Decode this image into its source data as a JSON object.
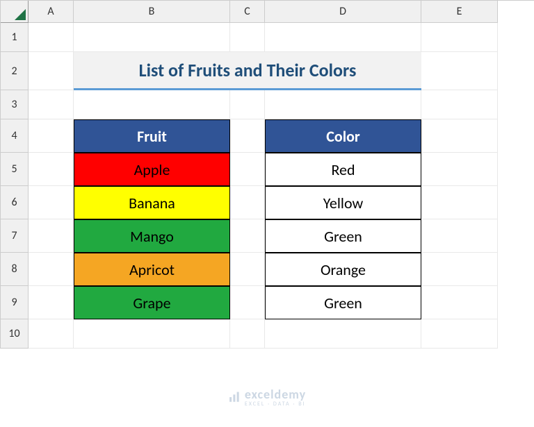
{
  "columns": [
    "A",
    "B",
    "C",
    "D",
    "E"
  ],
  "rows": [
    "1",
    "2",
    "3",
    "4",
    "5",
    "6",
    "7",
    "8",
    "9",
    "10"
  ],
  "title": "List of Fruits and Their Colors",
  "table": {
    "fruit_header": "Fruit",
    "color_header": "Color",
    "rows": [
      {
        "fruit": "Apple",
        "color": "Red",
        "fill": "red"
      },
      {
        "fruit": "Banana",
        "color": "Yellow",
        "fill": "yellow"
      },
      {
        "fruit": "Mango",
        "color": "Green",
        "fill": "green"
      },
      {
        "fruit": "Apricot",
        "color": "Orange",
        "fill": "orange"
      },
      {
        "fruit": "Grape",
        "color": "Green",
        "fill": "green"
      }
    ]
  },
  "watermark": {
    "brand": "exceldemy",
    "tagline": "EXCEL · DATA · BI"
  },
  "colors": {
    "header_bg": "#305496",
    "title_underline": "#5b9bd5",
    "title_text": "#1f4e79",
    "red": "#ff0000",
    "yellow": "#ffff00",
    "green": "#21a940",
    "orange": "#f5a623"
  }
}
